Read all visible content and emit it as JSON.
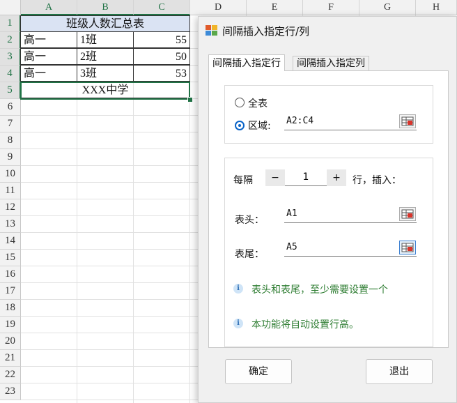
{
  "sheet": {
    "columns": [
      "A",
      "B",
      "C",
      "D",
      "E",
      "F",
      "G",
      "H"
    ],
    "rows": [
      "1",
      "2",
      "3",
      "4",
      "5",
      "6",
      "7",
      "8",
      "9",
      "10",
      "11",
      "12",
      "13",
      "14",
      "15",
      "16",
      "17",
      "18",
      "19",
      "20",
      "21",
      "22",
      "23"
    ],
    "title": "班级人数汇总表",
    "data": [
      {
        "school": "高一",
        "class": "1班",
        "count": "55"
      },
      {
        "school": "高一",
        "class": "2班",
        "count": "50"
      },
      {
        "school": "高一",
        "class": "3班",
        "count": "53"
      }
    ],
    "footer": "XXX中学"
  },
  "dialog": {
    "title": "间隔插入指定行/列",
    "tabs": [
      "间隔插入指定行",
      "间隔插入指定列"
    ],
    "radio_all": "全表",
    "radio_range": "区域:",
    "range_value": "A2:C4",
    "every_label": "每隔",
    "minus": "−",
    "step_value": "1",
    "plus": "+",
    "row_insert_label": "行，插入：",
    "header_label": "表头：",
    "header_value": "A1",
    "footer_label": "表尾：",
    "footer_value": "A5",
    "info1": "表头和表尾，至少需要设置一个",
    "info2": "本功能将自动设置行高。",
    "ok": "确定",
    "exit": "退出",
    "icons": {
      "info": "info-icon",
      "picker": "range-picker-icon",
      "app": "app-icon"
    },
    "accent": "#0a64c8",
    "info_color": "#2e7d32"
  }
}
